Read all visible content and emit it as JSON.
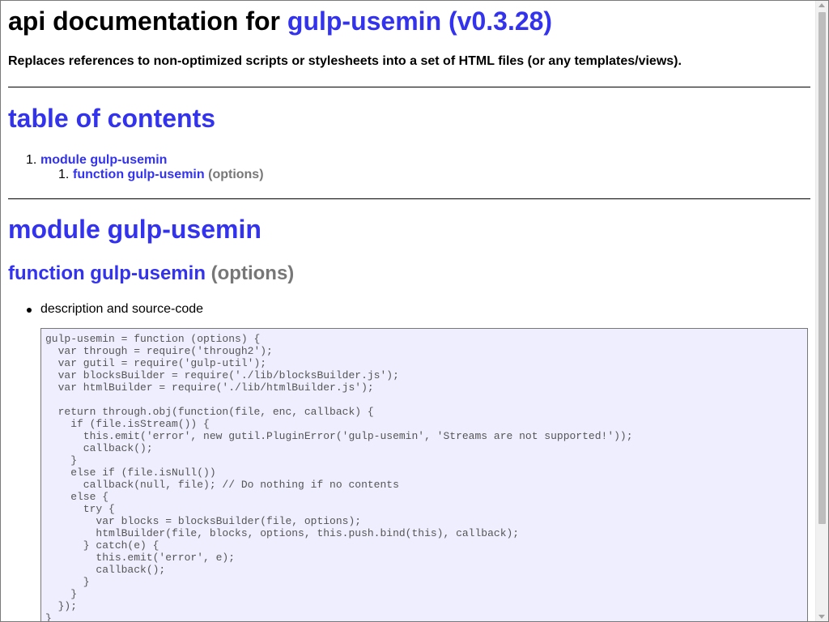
{
  "header": {
    "title_prefix": "api documentation for",
    "title_link": "gulp-usemin (v0.3.28)",
    "description": "Replaces references to non-optimized scripts or stylesheets into a set of HTML files (or any templates/views)."
  },
  "toc": {
    "title": "table of contents",
    "items": [
      {
        "number": "1.",
        "label": "module gulp-usemin"
      }
    ],
    "subitems": [
      {
        "number": "1.",
        "label": "function gulp-usemin",
        "args": "(options)"
      }
    ]
  },
  "module": {
    "title": "module gulp-usemin",
    "function_name": "function gulp-usemin",
    "function_args": "(options)",
    "bullet": "description and source-code",
    "code": "gulp-usemin = function (options) {\n  var through = require('through2');\n  var gutil = require('gulp-util');\n  var blocksBuilder = require('./lib/blocksBuilder.js');\n  var htmlBuilder = require('./lib/htmlBuilder.js');\n\n  return through.obj(function(file, enc, callback) {\n    if (file.isStream()) {\n      this.emit('error', new gutil.PluginError('gulp-usemin', 'Streams are not supported!'));\n      callback();\n    }\n    else if (file.isNull())\n      callback(null, file); // Do nothing if no contents\n    else {\n      try {\n        var blocks = blocksBuilder(file, options);\n        htmlBuilder(file, blocks, options, this.push.bind(this), callback);\n      } catch(e) {\n        this.emit('error', e);\n        callback();\n      }\n    }\n  });\n}"
  },
  "colors": {
    "accent": "#3333ee",
    "muted": "#777777",
    "code_bg": "#eeeeff",
    "code_text": "#555555"
  }
}
